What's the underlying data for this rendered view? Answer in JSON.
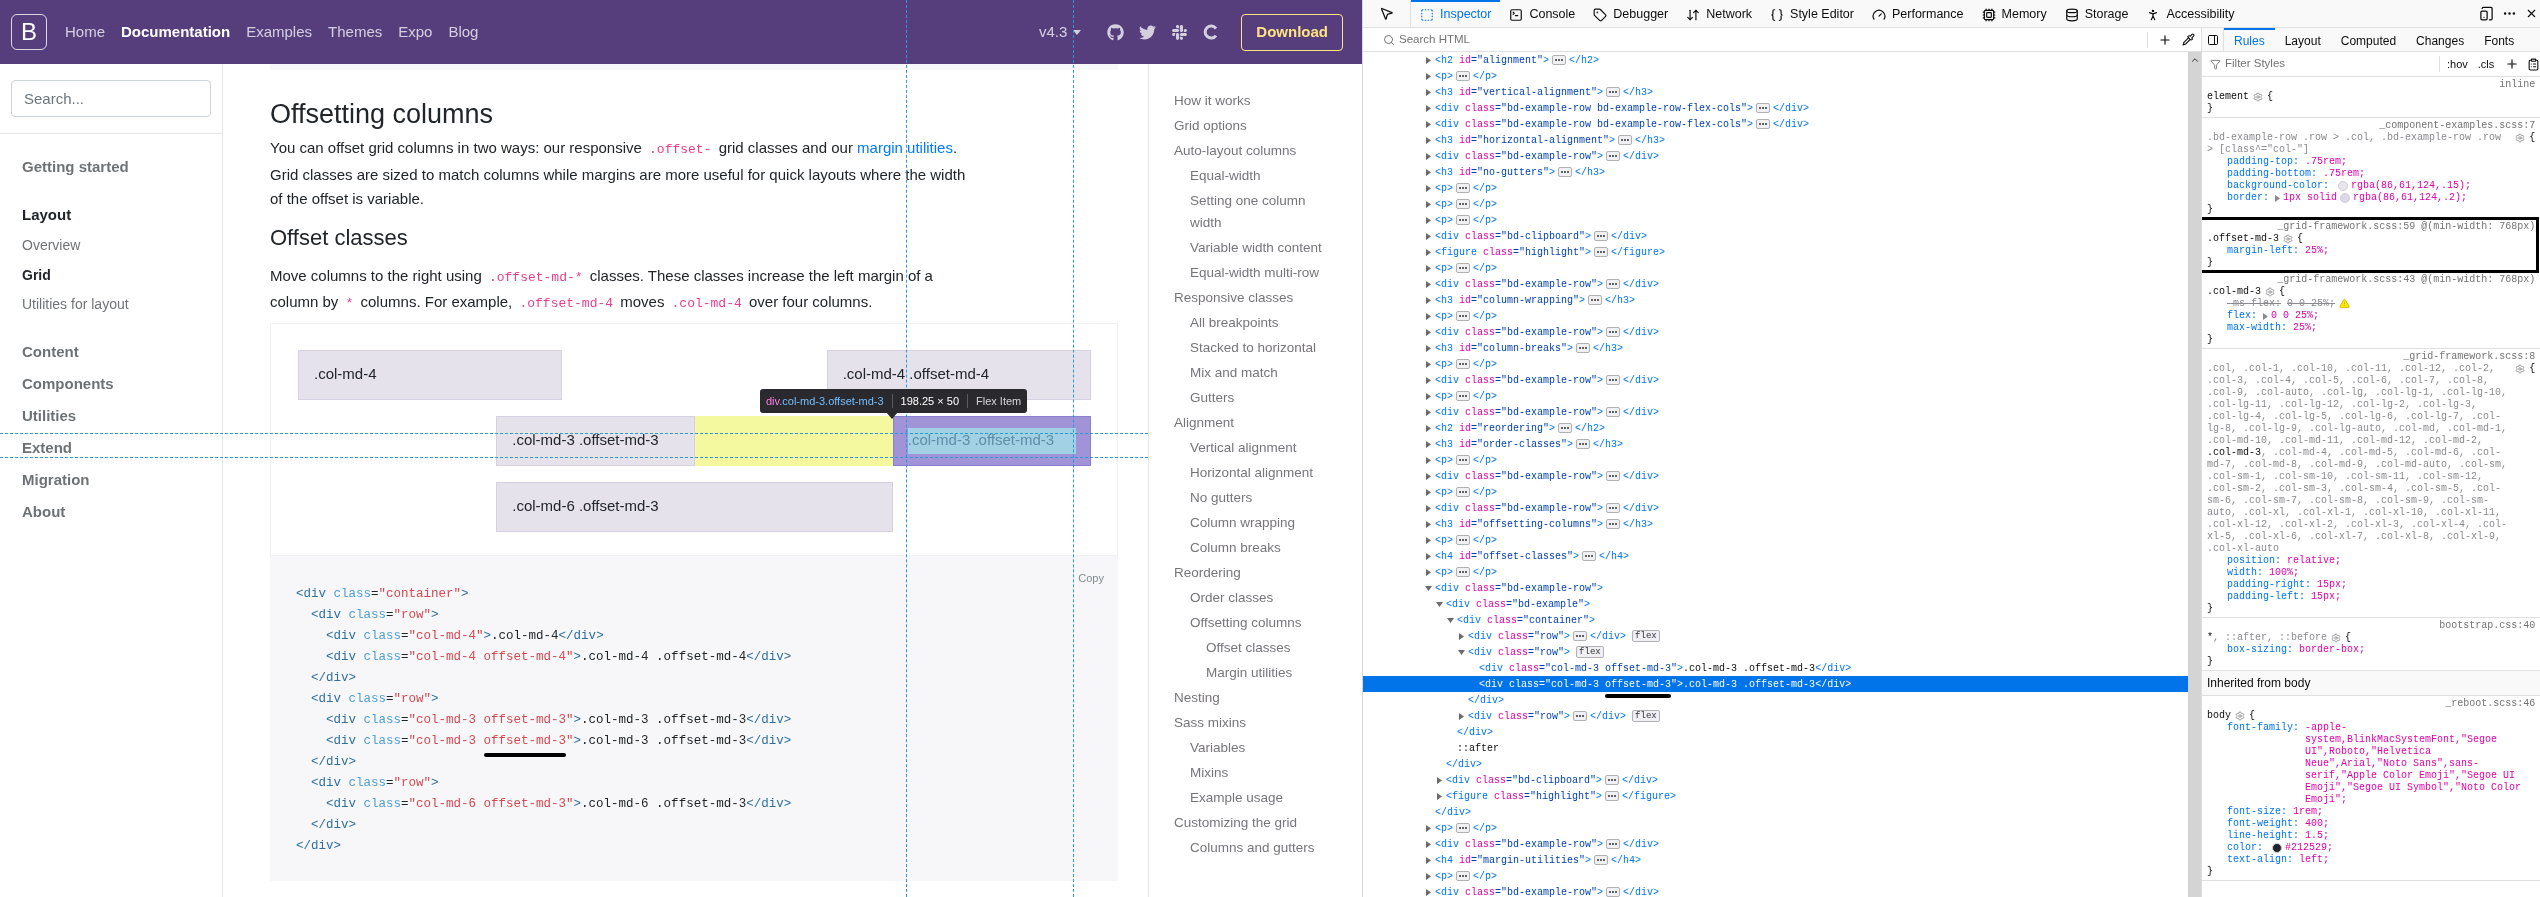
{
  "navbar": {
    "brand": "B",
    "links": [
      {
        "label": "Home",
        "selected": false
      },
      {
        "label": "Documentation",
        "selected": true
      },
      {
        "label": "Examples",
        "selected": false
      },
      {
        "label": "Themes",
        "selected": false
      },
      {
        "label": "Expo",
        "selected": false
      },
      {
        "label": "Blog",
        "selected": false
      }
    ],
    "version": "v4.3",
    "download": "Download"
  },
  "sidebar": {
    "search_placeholder": "Search...",
    "sections": [
      {
        "label": "Getting started",
        "selected": false
      },
      {
        "label": "Layout",
        "selected": true,
        "children": [
          {
            "label": "Overview",
            "selected": false
          },
          {
            "label": "Grid",
            "selected": true
          },
          {
            "label": "Utilities for layout",
            "selected": false
          }
        ]
      },
      {
        "label": "Content",
        "selected": false
      },
      {
        "label": "Components",
        "selected": false
      },
      {
        "label": "Utilities",
        "selected": false
      },
      {
        "label": "Extend",
        "selected": false
      },
      {
        "label": "Migration",
        "selected": false
      },
      {
        "label": "About",
        "selected": false
      }
    ]
  },
  "content": {
    "title": "Offsetting columns",
    "intro": [
      {
        "kind": "text",
        "text": "You can offset grid columns in two ways: our responsive "
      },
      {
        "kind": "code",
        "text": ".offset-"
      },
      {
        "kind": "text",
        "text": " grid classes and our "
      },
      {
        "kind": "link",
        "text": "margin utilities"
      },
      {
        "kind": "text",
        "text": ". Grid classes are sized to match columns while margins are more useful for quick layouts where the width of the offset is variable."
      }
    ],
    "subtitle": "Offset classes",
    "body": [
      {
        "kind": "text",
        "text": "Move columns to the right using "
      },
      {
        "kind": "code",
        "text": ".offset-md-*"
      },
      {
        "kind": "text",
        "text": " classes. These classes increase the left margin of a column by "
      },
      {
        "kind": "code",
        "text": "*"
      },
      {
        "kind": "text",
        "text": " columns. For example, "
      },
      {
        "kind": "code",
        "text": ".offset-md-4"
      },
      {
        "kind": "text",
        "text": " moves "
      },
      {
        "kind": "code",
        "text": ".col-md-4"
      },
      {
        "kind": "text",
        "text": " over four columns."
      }
    ],
    "example_rows": [
      [
        {
          "label": ".col-md-4",
          "highlighted": false
        },
        {
          "label": ".col-md-4 .offset-md-4",
          "highlighted": false
        }
      ],
      [
        {
          "label": ".col-md-3 .offset-md-3",
          "highlighted": false
        },
        {
          "label": ".col-md-3 .offset-md-3",
          "highlighted": true
        }
      ],
      [
        {
          "label": ".col-md-6 .offset-md-3",
          "highlighted": false
        }
      ]
    ],
    "tooltip": {
      "tag": "div",
      "classes": ".col-md-3.offset-md-3",
      "size": "198.25 × 50",
      "role": "Flex Item"
    },
    "copy": "Copy",
    "code_lines": [
      {
        "text": "<div class=\"container\">"
      },
      {
        "text": "  <div class=\"row\">"
      },
      {
        "text": "    <div class=\"col-md-4\">.col-md-4</div>"
      },
      {
        "text": "    <div class=\"col-md-4 offset-md-4\">.col-md-4 .offset-md-4</div>"
      },
      {
        "text": "  </div>"
      },
      {
        "text": "  <div class=\"row\">"
      },
      {
        "text": "    <div class=\"col-md-3 offset-md-3\">.col-md-3 .offset-md-3</div>"
      },
      {
        "parts": [
          {
            "text": "    <div class=\"col-md-3 ",
            "underlined": false
          },
          {
            "text": "offset-md-3",
            "underlined": true
          },
          {
            "text": "\">.col-md-3 .offset-md-3</div>",
            "underlined": false
          }
        ]
      },
      {
        "text": "  </div>"
      },
      {
        "text": "  <div class=\"row\">"
      },
      {
        "text": "    <div class=\"col-md-6 offset-md-3\">.col-md-6 .offset-md-3</div>"
      },
      {
        "text": "  </div>"
      },
      {
        "text": "</div>"
      }
    ]
  },
  "toc": [
    {
      "label": "How it works"
    },
    {
      "label": "Grid options"
    },
    {
      "label": "Auto-layout columns",
      "children": [
        {
          "label": "Equal-width"
        },
        {
          "label": "Setting one column width"
        },
        {
          "label": "Variable width content"
        },
        {
          "label": "Equal-width multi-row"
        }
      ]
    },
    {
      "label": "Responsive classes",
      "children": [
        {
          "label": "All breakpoints"
        },
        {
          "label": "Stacked to horizontal"
        },
        {
          "label": "Mix and match"
        },
        {
          "label": "Gutters"
        }
      ]
    },
    {
      "label": "Alignment",
      "children": [
        {
          "label": "Vertical alignment"
        },
        {
          "label": "Horizontal alignment"
        },
        {
          "label": "No gutters"
        },
        {
          "label": "Column wrapping"
        },
        {
          "label": "Column breaks"
        }
      ]
    },
    {
      "label": "Reordering",
      "children": [
        {
          "label": "Order classes"
        },
        {
          "label": "Offsetting columns",
          "children": [
            {
              "label": "Offset classes"
            },
            {
              "label": "Margin utilities"
            }
          ]
        }
      ]
    },
    {
      "label": "Nesting"
    },
    {
      "label": "Sass mixins",
      "children": [
        {
          "label": "Variables"
        },
        {
          "label": "Mixins"
        },
        {
          "label": "Example usage"
        }
      ]
    },
    {
      "label": "Customizing the grid",
      "children": [
        {
          "label": "Columns and gutters"
        }
      ]
    }
  ],
  "devtools": {
    "tabs": [
      {
        "label": "Inspector",
        "selected": true
      },
      {
        "label": "Console",
        "selected": false
      },
      {
        "label": "Debugger",
        "selected": false
      },
      {
        "label": "Network",
        "selected": false
      },
      {
        "label": "Style Editor",
        "selected": false
      },
      {
        "label": "Performance",
        "selected": false
      },
      {
        "label": "Memory",
        "selected": false
      },
      {
        "label": "Storage",
        "selected": false
      },
      {
        "label": "Accessibility",
        "selected": false
      }
    ],
    "search_placeholder": "Search HTML",
    "markup_tree": [
      {
        "text": "<h2 id=\"alignment\">",
        "closing": "</h2>",
        "expanded": false,
        "selected": false
      },
      {
        "text": "<p>",
        "closing": "</p>",
        "expanded": false,
        "selected": false
      },
      {
        "text": "<h3 id=\"vertical-alignment\">",
        "closing": "</h3>",
        "expanded": false,
        "selected": false
      },
      {
        "text": "<div class=\"bd-example-row bd-example-row-flex-cols\">",
        "closing": "</div>",
        "expanded": false,
        "selected": false
      },
      {
        "text": "<div class=\"bd-example-row bd-example-row-flex-cols\">",
        "closing": "</div>",
        "expanded": false,
        "selected": false
      },
      {
        "text": "<h3 id=\"horizontal-alignment\">",
        "closing": "</h3>",
        "expanded": false,
        "selected": false
      },
      {
        "text": "<div class=\"bd-example-row\">",
        "closing": "</div>",
        "expanded": false,
        "selected": false
      },
      {
        "text": "<h3 id=\"no-gutters\">",
        "closing": "</h3>",
        "expanded": false,
        "selected": false
      },
      {
        "text": "<p>",
        "closing": "</p>",
        "expanded": false,
        "selected": false
      },
      {
        "text": "<p>",
        "closing": "</p>",
        "expanded": false,
        "selected": false
      },
      {
        "text": "<p>",
        "closing": "</p>",
        "expanded": false,
        "selected": false
      },
      {
        "text": "<div class=\"bd-clipboard\">",
        "closing": "</div>",
        "expanded": false,
        "selected": false
      },
      {
        "text": "<figure class=\"highlight\">",
        "closing": "</figure>",
        "expanded": false,
        "selected": false
      },
      {
        "text": "<p>",
        "closing": "</p>",
        "expanded": false,
        "selected": false
      },
      {
        "text": "<div class=\"bd-example-row\">",
        "closing": "</div>",
        "expanded": false,
        "selected": false
      },
      {
        "text": "<h3 id=\"column-wrapping\">",
        "closing": "</h3>",
        "expanded": false,
        "selected": false
      },
      {
        "text": "<p>",
        "closing": "</p>",
        "expanded": false,
        "selected": false
      },
      {
        "text": "<div class=\"bd-example-row\">",
        "closing": "</div>",
        "expanded": false,
        "selected": false
      },
      {
        "text": "<h3 id=\"column-breaks\">",
        "closing": "</h3>",
        "expanded": false,
        "selected": false
      },
      {
        "text": "<p>",
        "closing": "</p>",
        "expanded": false,
        "selected": false
      },
      {
        "text": "<div class=\"bd-example-row\">",
        "closing": "</div>",
        "expanded": false,
        "selected": false
      },
      {
        "text": "<p>",
        "closing": "</p>",
        "expanded": false,
        "selected": false
      },
      {
        "text": "<div class=\"bd-example-row\">",
        "closing": "</div>",
        "expanded": false,
        "selected": false
      },
      {
        "text": "<h2 id=\"reordering\">",
        "closing": "</h2>",
        "expanded": false,
        "selected": false
      },
      {
        "text": "<h3 id=\"order-classes\">",
        "closing": "</h3>",
        "expanded": false,
        "selected": false
      },
      {
        "text": "<p>",
        "closing": "</p>",
        "expanded": false,
        "selected": false
      },
      {
        "text": "<div class=\"bd-example-row\">",
        "closing": "</div>",
        "expanded": false,
        "selected": false
      },
      {
        "text": "<p>",
        "closing": "</p>",
        "expanded": false,
        "selected": false
      },
      {
        "text": "<div class=\"bd-example-row\">",
        "closing": "</div>",
        "expanded": false,
        "selected": false
      },
      {
        "text": "<h3 id=\"offsetting-columns\">",
        "closing": "</h3>",
        "expanded": false,
        "selected": false
      },
      {
        "text": "<p>",
        "closing": "</p>",
        "expanded": false,
        "selected": false
      },
      {
        "text": "<h4 id=\"offset-classes\">",
        "closing": "</h4>",
        "expanded": false,
        "selected": false
      },
      {
        "text": "<p>",
        "closing": "</p>",
        "expanded": false,
        "selected": false
      },
      {
        "text": "<div class=\"bd-example-row\">",
        "expanded": true,
        "selected": false,
        "end": "</div>",
        "children": [
          {
            "text": "<div class=\"bd-example\">",
            "expanded": true,
            "selected": false,
            "end": "</div>",
            "children": [
              {
                "text": "<div class=\"container\">",
                "expanded": true,
                "selected": false,
                "end": "</div>",
                "children": [
                  {
                    "text": "<div class=\"row\">",
                    "closing": "</div>",
                    "badge": "flex",
                    "expanded": false,
                    "selected": false
                  },
                  {
                    "text": "<div class=\"row\">",
                    "badge": "flex",
                    "expanded": true,
                    "selected": false,
                    "end": "</div>",
                    "children": [
                      {
                        "text": "<div class=\"col-md-3 offset-md-3\">.col-md-3 .offset-md-3</div>",
                        "selected": false
                      },
                      {
                        "parts": [
                          {
                            "text": "<div class=\"col-md-3 ",
                            "underlined": false
                          },
                          {
                            "text": "offset-md-3",
                            "underlined": true
                          },
                          {
                            "text": "\">.col-md-3 .offset-md-3</div>",
                            "underlined": false
                          }
                        ],
                        "selected": true
                      }
                    ]
                  },
                  {
                    "text": "<div class=\"row\">",
                    "closing": "</div>",
                    "badge": "flex",
                    "expanded": false,
                    "selected": false
                  }
                ]
              },
              {
                "text": "::after",
                "selected": false
              }
            ]
          },
          {
            "text": "<div class=\"bd-clipboard\">",
            "closing": "</div>",
            "expanded": false,
            "selected": false
          },
          {
            "text": "<figure class=\"highlight\">",
            "closing": "</figure>",
            "expanded": false,
            "selected": false
          }
        ]
      },
      {
        "text": "<p>",
        "closing": "</p>",
        "expanded": false,
        "selected": false
      },
      {
        "text": "<div class=\"bd-example-row\">",
        "closing": "</div>",
        "expanded": false,
        "selected": false
      },
      {
        "text": "<h4 id=\"margin-utilities\">",
        "closing": "</h4>",
        "expanded": false,
        "selected": false
      },
      {
        "text": "<p>",
        "closing": "</p>",
        "expanded": false,
        "selected": false
      },
      {
        "text": "<div class=\"bd-example-row\">",
        "closing": "</div>",
        "expanded": false,
        "selected": false
      }
    ],
    "sidebar_tabs": [
      {
        "label": "Rules",
        "selected": true
      },
      {
        "label": "Layout",
        "selected": false
      },
      {
        "label": "Computed",
        "selected": false
      },
      {
        "label": "Changes",
        "selected": false
      },
      {
        "label": "Fonts",
        "selected": false
      }
    ],
    "filter_placeholder": "Filter Styles",
    "hov": ":hov",
    "cls": ".cls",
    "rules": [
      {
        "kind": "rule",
        "annotated": false,
        "selector": [
          {
            "text": "element",
            "matched": true
          }
        ],
        "source": "inline",
        "open_brace": "{",
        "close_brace": "}"
      },
      {
        "kind": "rule",
        "annotated": false,
        "selector": [
          {
            "text": ".bd-example-row .row > .col, .bd-example-row .row > [class^=\"col-\"]",
            "matched": false
          }
        ],
        "source": "_component-examples.scss:7",
        "open_brace": "{",
        "close_brace": "}",
        "declarations": [
          {
            "name": "padding-top:",
            "value": ".75rem;",
            "overridden": false,
            "warning": false,
            "expandable": false
          },
          {
            "name": "padding-bottom:",
            "value": ".75rem;",
            "overridden": false,
            "warning": false,
            "expandable": false
          },
          {
            "name": "background-color:",
            "color": "#e9e5ee",
            "color_value": "rgba(86,61,124,.15);",
            "overridden": false,
            "warning": false,
            "expandable": false
          },
          {
            "name": "border:",
            "value": "1px solid",
            "color": "#ddd8e5",
            "color_value": "rgba(86,61,124,.2);",
            "overridden": false,
            "warning": false,
            "expandable": true
          }
        ]
      },
      {
        "kind": "rule",
        "annotated": true,
        "selector": [
          {
            "text": ".offset-md-3",
            "matched": true
          }
        ],
        "source": "_grid-framework.scss:59 @(min-width: 768px)",
        "open_brace": "{",
        "close_brace": "}",
        "declarations": [
          {
            "name": "margin-left:",
            "value": "25%;",
            "overridden": false,
            "warning": false,
            "expandable": false
          }
        ]
      },
      {
        "kind": "rule",
        "annotated": false,
        "selector": [
          {
            "text": ".col-md-3",
            "matched": true
          }
        ],
        "source": "_grid-framework.scss:43 @(min-width: 768px)",
        "open_brace": "{",
        "close_brace": "}",
        "declarations": [
          {
            "name": "-ms-flex:",
            "value": "0 0 25%;",
            "overridden": true,
            "warning": true,
            "expandable": false
          },
          {
            "name": "flex:",
            "value": "0 0 25%;",
            "overridden": false,
            "warning": false,
            "expandable": true
          },
          {
            "name": "max-width:",
            "value": "25%;",
            "overridden": false,
            "warning": false,
            "expandable": false
          }
        ]
      },
      {
        "kind": "rule",
        "annotated": false,
        "selector": [
          {
            "text": ".col, .col-1, .col-10, .col-11, .col-12, .col-2, .col-3, .col-4, .col-5, .col-6, .col-7, .col-8, .col-9, .col-auto, .col-lg, .col-lg-1, .col-lg-10, .col-lg-11, .col-lg-12, .col-lg-2, .col-lg-3, .col-lg-4, .col-lg-5, .col-lg-6, .col-lg-7, .col-lg-8, .col-lg-9, .col-lg-auto, .col-md, .col-md-1, .col-md-10, .col-md-11, .col-md-12, .col-md-2, ",
            "matched": false
          },
          {
            "text": ".col-md-3",
            "matched": true
          },
          {
            "text": ", .col-md-4, .col-md-5, .col-md-6, .col-md-7, .col-md-8, .col-md-9, .col-md-auto, .col-sm, .col-sm-1, .col-sm-10, .col-sm-11, .col-sm-12, .col-sm-2, .col-sm-3, .col-sm-4, .col-sm-5, .col-sm-6, .col-sm-7, .col-sm-8, .col-sm-9, .col-sm-auto, .col-xl, .col-xl-1, .col-xl-10, .col-xl-11, .col-xl-12, .col-xl-2, .col-xl-3, .col-xl-4, .col-xl-5, .col-xl-6, .col-xl-7, .col-xl-8, .col-xl-9, .col-xl-auto",
            "matched": false
          }
        ],
        "source": "_grid-framework.scss:8",
        "open_brace": "{",
        "close_brace": "}",
        "declarations": [
          {
            "name": "position:",
            "value": "relative;",
            "overridden": false,
            "warning": false,
            "expandable": false
          },
          {
            "name": "width:",
            "value": "100%;",
            "overridden": false,
            "warning": false,
            "expandable": false
          },
          {
            "name": "padding-right:",
            "value": "15px;",
            "overridden": false,
            "warning": false,
            "expandable": false
          },
          {
            "name": "padding-left:",
            "value": "15px;",
            "overridden": false,
            "warning": false,
            "expandable": false
          }
        ]
      },
      {
        "kind": "rule",
        "annotated": false,
        "selector": [
          {
            "text": "*",
            "matched": true
          },
          {
            "text": ", ::after, ::before",
            "matched": false
          }
        ],
        "source": "bootstrap.css:40",
        "open_brace": "{",
        "close_brace": "}",
        "declarations": [
          {
            "name": "box-sizing:",
            "value": "border-box;",
            "overridden": false,
            "warning": false,
            "expandable": false
          }
        ]
      },
      {
        "kind": "inherited",
        "label": "Inherited from body"
      },
      {
        "kind": "rule",
        "annotated": false,
        "selector": [
          {
            "text": "body",
            "matched": true
          }
        ],
        "source": "_reboot.scss:46",
        "open_brace": "{",
        "close_brace": "}",
        "declarations": [
          {
            "name": "font-family:",
            "value": "-apple-system,BlinkMacSystemFont,\"Segoe UI\",Roboto,\"Helvetica Neue\",Arial,\"Noto Sans\",sans-serif,\"Apple Color Emoji\",\"Segoe UI Emoji\",\"Segoe UI Symbol\",\"Noto Color Emoji\";",
            "overridden": false,
            "warning": false,
            "expandable": false
          },
          {
            "name": "font-size:",
            "value": "1rem;",
            "overridden": false,
            "warning": false,
            "expandable": false
          },
          {
            "name": "font-weight:",
            "value": "400;",
            "overridden": false,
            "warning": false,
            "expandable": false
          },
          {
            "name": "line-height:",
            "value": "1.5;",
            "overridden": false,
            "warning": false,
            "expandable": false
          },
          {
            "name": "color:",
            "color": "#212529",
            "color_value": "#212529;",
            "overridden": false,
            "warning": false,
            "expandable": false
          },
          {
            "name": "text-align:",
            "value": "left;",
            "overridden": false,
            "warning": false,
            "expandable": false
          }
        ]
      }
    ]
  }
}
